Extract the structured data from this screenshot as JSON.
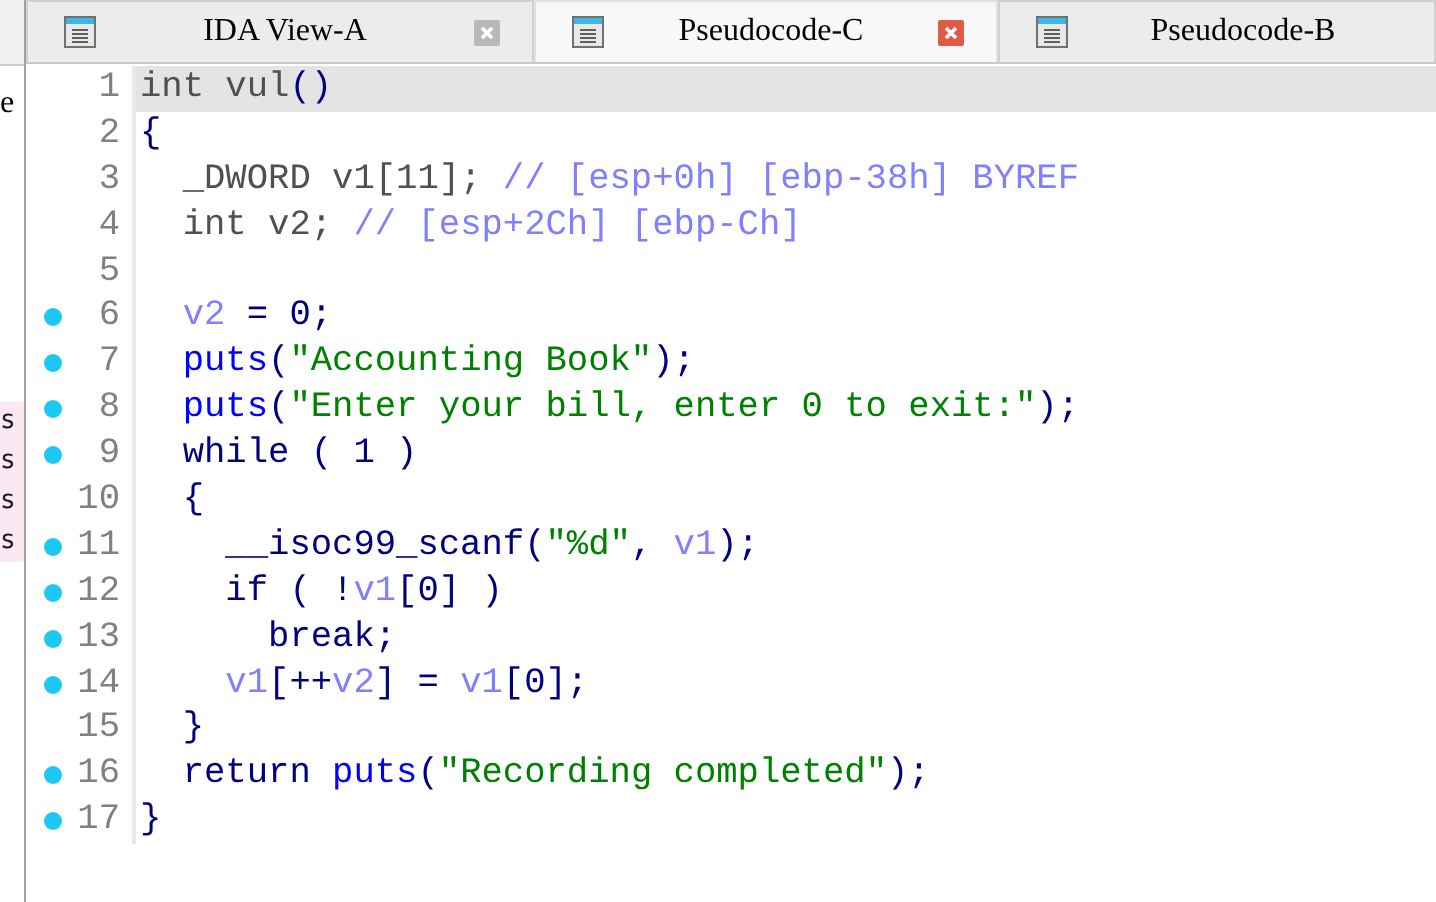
{
  "side_panel": {
    "texts": [
      "e",
      "s",
      "s",
      "s",
      "s"
    ]
  },
  "tabs": [
    {
      "label": "IDA View-A",
      "selected": false,
      "closable": true
    },
    {
      "label": "Pseudocode-C",
      "selected": true,
      "closable": true
    },
    {
      "label": "Pseudocode-B",
      "selected": false,
      "closable": false
    }
  ],
  "code": {
    "lines": [
      {
        "number": "1",
        "breakpoint": false,
        "current": true,
        "tokens": [
          {
            "kind": "dim",
            "text": "int vul"
          },
          {
            "kind": "plain",
            "text": "()"
          }
        ]
      },
      {
        "number": "2",
        "breakpoint": false,
        "current": false,
        "tokens": [
          {
            "kind": "plain",
            "text": "{"
          }
        ]
      },
      {
        "number": "3",
        "breakpoint": false,
        "current": false,
        "tokens": [
          {
            "kind": "dim",
            "text": "  _DWORD v1[11];"
          },
          {
            "kind": "comment",
            "text": " // [esp+0h] [ebp-38h] BYREF"
          }
        ]
      },
      {
        "number": "4",
        "breakpoint": false,
        "current": false,
        "tokens": [
          {
            "kind": "dim",
            "text": "  int v2;"
          },
          {
            "kind": "comment",
            "text": " // [esp+2Ch] [ebp-Ch]"
          }
        ]
      },
      {
        "number": "5",
        "breakpoint": false,
        "current": false
      },
      {
        "number": "6",
        "breakpoint": true,
        "current": false,
        "tokens": [
          {
            "kind": "var",
            "text": "  v2"
          },
          {
            "kind": "plain",
            "text": " = 0;"
          }
        ]
      },
      {
        "number": "7",
        "breakpoint": true,
        "current": false,
        "tokens": [
          {
            "kind": "func",
            "text": "  puts"
          },
          {
            "kind": "plain",
            "text": "("
          },
          {
            "kind": "string",
            "text": "\"Accounting Book\""
          },
          {
            "kind": "plain",
            "text": ");"
          }
        ]
      },
      {
        "number": "8",
        "breakpoint": true,
        "current": false,
        "tokens": [
          {
            "kind": "func",
            "text": "  puts"
          },
          {
            "kind": "plain",
            "text": "("
          },
          {
            "kind": "string",
            "text": "\"Enter your bill, enter 0 to exit:\""
          },
          {
            "kind": "plain",
            "text": ");"
          }
        ]
      },
      {
        "number": "9",
        "breakpoint": true,
        "current": false,
        "tokens": [
          {
            "kind": "plain",
            "text": "  while ( 1 )"
          }
        ]
      },
      {
        "number": "10",
        "breakpoint": false,
        "current": false,
        "tokens": [
          {
            "kind": "plain",
            "text": "  {"
          }
        ]
      },
      {
        "number": "11",
        "breakpoint": true,
        "current": false,
        "tokens": [
          {
            "kind": "plain",
            "text": "    __isoc99_scanf("
          },
          {
            "kind": "string",
            "text": "\"%d\""
          },
          {
            "kind": "plain",
            "text": ", "
          },
          {
            "kind": "var",
            "text": "v1"
          },
          {
            "kind": "plain",
            "text": ");"
          }
        ]
      },
      {
        "number": "12",
        "breakpoint": true,
        "current": false,
        "tokens": [
          {
            "kind": "plain",
            "text": "    if ( !"
          },
          {
            "kind": "var",
            "text": "v1"
          },
          {
            "kind": "plain",
            "text": "[0] )"
          }
        ]
      },
      {
        "number": "13",
        "breakpoint": true,
        "current": false,
        "tokens": [
          {
            "kind": "plain",
            "text": "      break;"
          }
        ]
      },
      {
        "number": "14",
        "breakpoint": true,
        "current": false,
        "tokens": [
          {
            "kind": "var",
            "text": "    v1"
          },
          {
            "kind": "plain",
            "text": "[++"
          },
          {
            "kind": "var",
            "text": "v2"
          },
          {
            "kind": "plain",
            "text": "] = "
          },
          {
            "kind": "var",
            "text": "v1"
          },
          {
            "kind": "plain",
            "text": "[0];"
          }
        ]
      },
      {
        "number": "15",
        "breakpoint": false,
        "current": false,
        "tokens": [
          {
            "kind": "plain",
            "text": "  }"
          }
        ]
      },
      {
        "number": "16",
        "breakpoint": true,
        "current": false,
        "tokens": [
          {
            "kind": "plain",
            "text": "  return "
          },
          {
            "kind": "func",
            "text": "puts"
          },
          {
            "kind": "plain",
            "text": "("
          },
          {
            "kind": "string",
            "text": "\"Recording completed\""
          },
          {
            "kind": "plain",
            "text": ");"
          }
        ]
      },
      {
        "number": "17",
        "breakpoint": true,
        "current": false,
        "tokens": [
          {
            "kind": "plain",
            "text": "}"
          }
        ]
      }
    ]
  }
}
